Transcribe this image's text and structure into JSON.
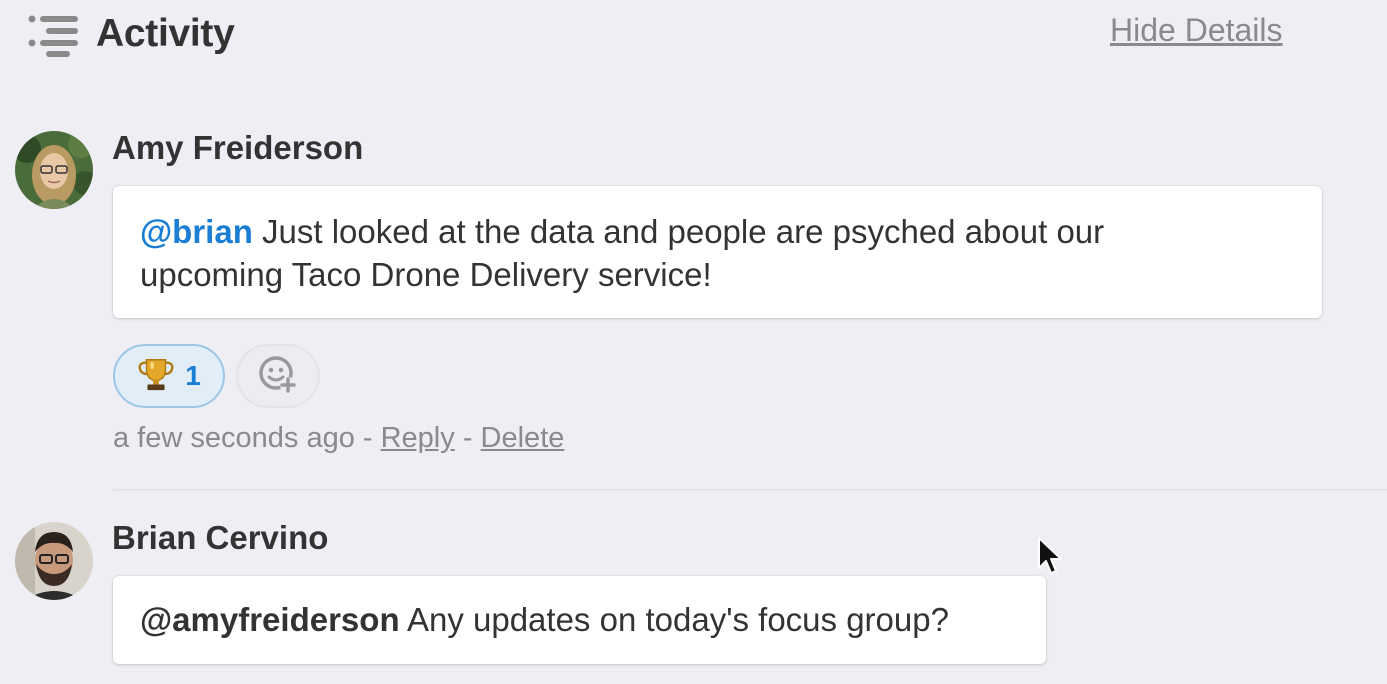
{
  "header": {
    "title": "Activity",
    "hide_details_label": "Hide Details"
  },
  "comments": [
    {
      "author": "Amy Freiderson",
      "mention": "@brian",
      "text_line1": " Just looked at the data and people are psyched about our",
      "text_line2": "upcoming Taco Drone Delivery service!",
      "reaction": {
        "emoji": "🏆",
        "count": "1"
      },
      "timestamp": "a few seconds ago",
      "separator": " - ",
      "reply_label": "Reply",
      "delete_label": "Delete"
    },
    {
      "author": "Brian Cervino",
      "mention": "@amyfreiderson",
      "text": " Any updates on today's focus group?"
    }
  ],
  "colors": {
    "background": "#efeef4",
    "mention_blue": "#1a7fd4",
    "muted_text": "#8a8a8a"
  },
  "icons": [
    "activity-list-icon",
    "trophy-icon",
    "add-reaction-icon",
    "mouse-cursor-icon"
  ]
}
